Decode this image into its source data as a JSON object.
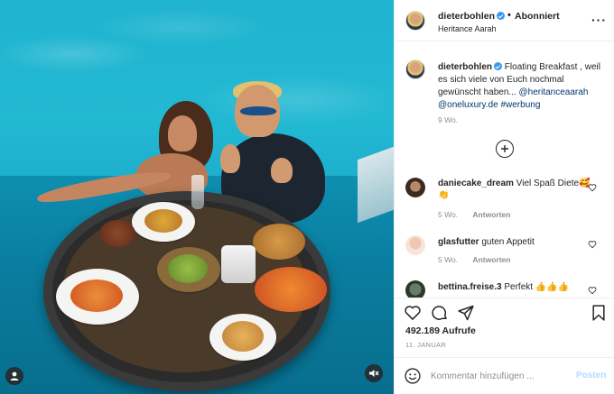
{
  "post": {
    "username": "dieterbohlen",
    "follow_label": "Abonniert",
    "separator": "•",
    "location": "Heritance Aarah",
    "more_label": "···"
  },
  "caption": {
    "username": "dieterbohlen",
    "text_plain": "Floating Breakfast , weil es sich viele von Euch nochmal gewünscht haben...",
    "mention_1": "@heritanceaarah",
    "mention_2": "@oneluxury.de",
    "hashtag": "#werbung",
    "time": "9 Wo."
  },
  "comments": [
    {
      "username": "daniecake_dream",
      "text": "Viel Spaß Diete🥰👏",
      "time": "5 Wo.",
      "reply_label": "Antworten"
    },
    {
      "username": "glasfutter",
      "text": "guten Appetit",
      "time": "5 Wo.",
      "reply_label": "Antworten"
    },
    {
      "username": "bettina.freise.3",
      "text": "Perfekt 👍👍👍"
    }
  ],
  "stats": {
    "views": "492.189 Aufrufe",
    "date": "11. JANUAR"
  },
  "comment_box": {
    "placeholder": "Kommentar hinzufügen ...",
    "post_label": "Posten"
  },
  "colors": {
    "link": "#00376b",
    "verified": "#3897f0",
    "post_disabled": "#b3dbff",
    "muted": "#8e8e8e"
  }
}
